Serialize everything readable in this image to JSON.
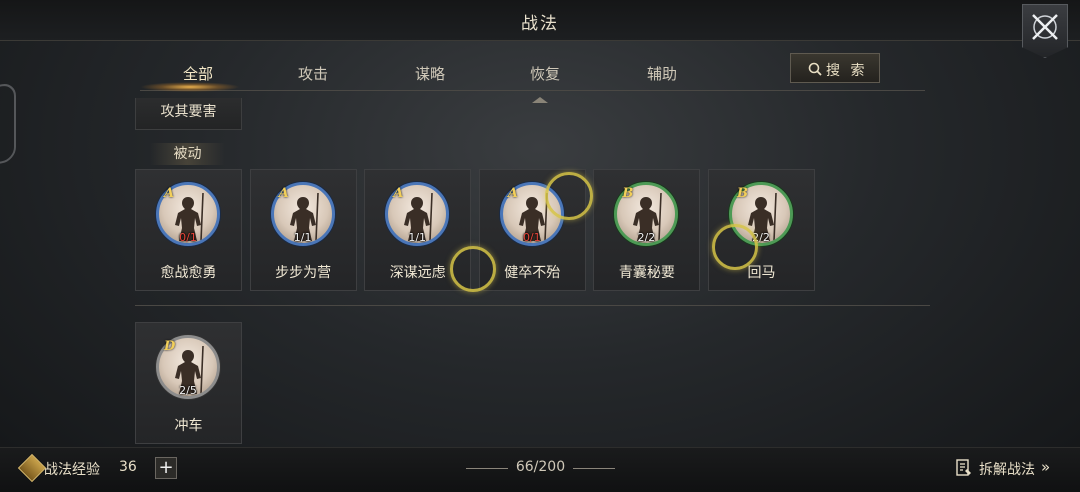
{
  "header": {
    "title": "战法"
  },
  "tabs": [
    {
      "label": "全部",
      "active": true
    },
    {
      "label": "攻击"
    },
    {
      "label": "谋略"
    },
    {
      "label": "恢复"
    },
    {
      "label": "辅助"
    }
  ],
  "search": {
    "label": "搜 索",
    "icon": "search-icon"
  },
  "partial_card": {
    "name": "攻其要害"
  },
  "section": {
    "label": "被动"
  },
  "skills_row1": [
    {
      "grade": "A",
      "count": "0/1",
      "count_color": "#e8453a",
      "name": "愈战愈勇"
    },
    {
      "grade": "A",
      "count": "1/1",
      "name": "步步为营"
    },
    {
      "grade": "A",
      "count": "1/1",
      "name": "深谋远虑"
    },
    {
      "grade": "A",
      "count": "0/1",
      "count_color": "#e8453a",
      "name": "健卒不殆"
    },
    {
      "grade": "B",
      "count": "2/2",
      "name": "青囊秘要"
    },
    {
      "grade": "B",
      "count": "2/2",
      "name": "回马"
    }
  ],
  "skills_row2": [
    {
      "grade": "D",
      "count": "2/5",
      "name": "冲车"
    }
  ],
  "footer": {
    "exp_label": "战法经验",
    "exp_value": "36",
    "plus": "+",
    "progress": "66/200",
    "decompose_label": "拆解战法",
    "decompose_chevron": "»"
  },
  "colors": {
    "grade_A": "#4a76b8",
    "grade_B": "#4d9a55",
    "grade_D": "#8c8c8c",
    "grade_letter": "#f2cf5a"
  }
}
